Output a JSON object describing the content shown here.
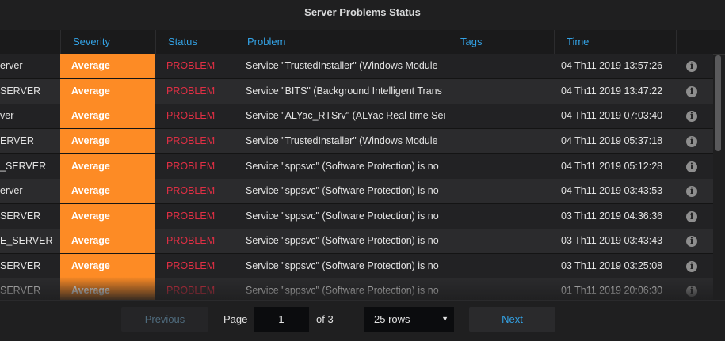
{
  "panel": {
    "title": "Server Problems Status"
  },
  "table": {
    "columns": {
      "severity": "Severity",
      "status": "Status",
      "problem": "Problem",
      "tags": "Tags",
      "time": "Time"
    },
    "rows": [
      {
        "host": "erver",
        "severity": "Average",
        "status": "PROBLEM",
        "problem": "Service \"TrustedInstaller\" (Windows Module",
        "tags": "",
        "time": "04 Th11 2019 13:57:26"
      },
      {
        "host": "SERVER",
        "severity": "Average",
        "status": "PROBLEM",
        "problem": "Service \"BITS\" (Background Intelligent Trans",
        "tags": "",
        "time": "04 Th11 2019 13:47:22"
      },
      {
        "host": "ver",
        "severity": "Average",
        "status": "PROBLEM",
        "problem": "Service \"ALYac_RTSrv\" (ALYac Real-time Ser",
        "tags": "",
        "time": "04 Th11 2019 07:03:40"
      },
      {
        "host": "ERVER",
        "severity": "Average",
        "status": "PROBLEM",
        "problem": "Service \"TrustedInstaller\" (Windows Module",
        "tags": "",
        "time": "04 Th11 2019 05:37:18"
      },
      {
        "host": "_SERVER",
        "severity": "Average",
        "status": "PROBLEM",
        "problem": "Service \"sppsvc\" (Software Protection) is no",
        "tags": "",
        "time": "04 Th11 2019 05:12:28"
      },
      {
        "host": "erver",
        "severity": "Average",
        "status": "PROBLEM",
        "problem": "Service \"sppsvc\" (Software Protection) is no",
        "tags": "",
        "time": "04 Th11 2019 03:43:53"
      },
      {
        "host": "SERVER",
        "severity": "Average",
        "status": "PROBLEM",
        "problem": "Service \"sppsvc\" (Software Protection) is no",
        "tags": "",
        "time": "03 Th11 2019 04:36:36"
      },
      {
        "host": "E_SERVER",
        "severity": "Average",
        "status": "PROBLEM",
        "problem": "Service \"sppsvc\" (Software Protection) is no",
        "tags": "",
        "time": "03 Th11 2019 03:43:43"
      },
      {
        "host": "SERVER",
        "severity": "Average",
        "status": "PROBLEM",
        "problem": "Service \"sppsvc\" (Software Protection) is no",
        "tags": "",
        "time": "03 Th11 2019 03:25:08"
      },
      {
        "host": "SERVER",
        "severity": "Average",
        "status": "PROBLEM",
        "problem": "Service \"sppsvc\" (Software Protection) is no",
        "tags": "",
        "time": "01 Th11 2019 20:06:30"
      }
    ],
    "info_icon": "info-icon"
  },
  "pagination": {
    "previous_label": "Previous",
    "page_label": "Page",
    "page_value": "1",
    "of_label": "of 3",
    "rows_label": "25 rows",
    "next_label": "Next"
  },
  "colors": {
    "severity_average": "#fd8b25",
    "status_problem": "#e02f44",
    "header_text": "#33a2e5"
  }
}
